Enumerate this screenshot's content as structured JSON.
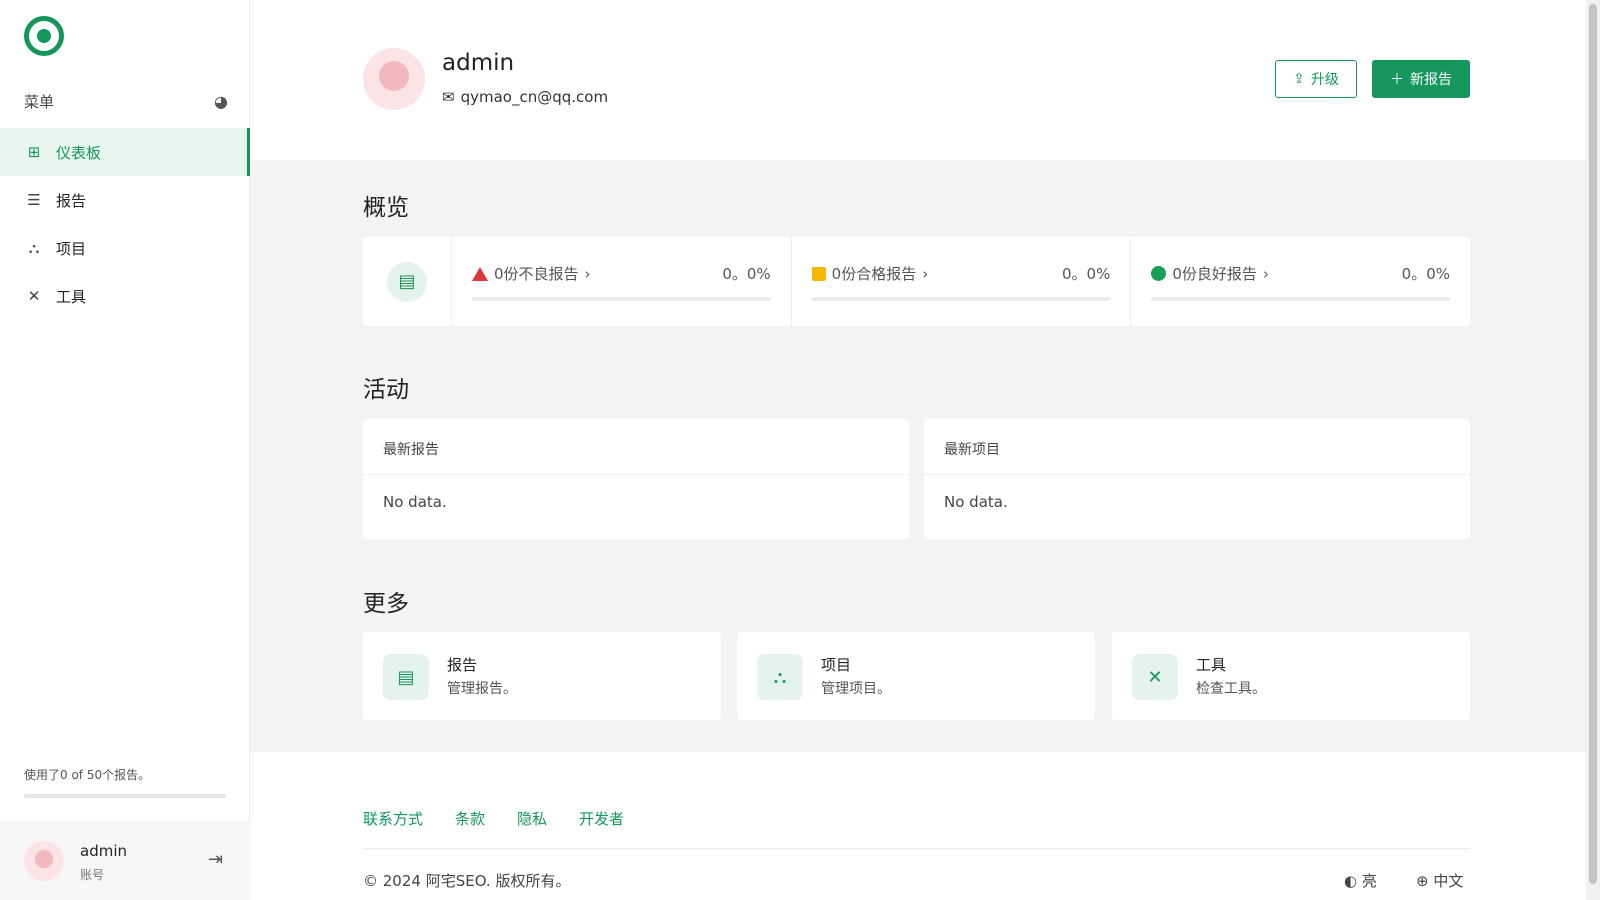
{
  "sidebar": {
    "menu_title": "菜单",
    "items": [
      {
        "label": "仪表板",
        "icon": "grid-icon"
      },
      {
        "label": "报告",
        "icon": "list-icon"
      },
      {
        "label": "项目",
        "icon": "project-icon"
      },
      {
        "label": "工具",
        "icon": "tools-icon"
      }
    ],
    "usage_text": "使用了0 of 50个报告。",
    "usage_fraction": 0,
    "user": {
      "name": "admin",
      "role": "账号"
    }
  },
  "header": {
    "name": "admin",
    "email": "qymao_cn@qq.com",
    "upgrade_label": "升级",
    "new_report_label": "新报告"
  },
  "overview": {
    "title": "概览",
    "items": [
      {
        "label": "0份不良报告",
        "percent": "0。0%",
        "status_color": "#d9363e"
      },
      {
        "label": "0份合格报告",
        "percent": "0。0%",
        "status_color": "#f5b800"
      },
      {
        "label": "0份良好报告",
        "percent": "0。0%",
        "status_color": "#18a058"
      }
    ]
  },
  "activity": {
    "title": "活动",
    "cards": [
      {
        "title": "最新报告",
        "empty": "No data."
      },
      {
        "title": "最新项目",
        "empty": "No data."
      }
    ]
  },
  "more": {
    "title": "更多",
    "cards": [
      {
        "title": "报告",
        "desc": "管理报告。"
      },
      {
        "title": "项目",
        "desc": "管理项目。"
      },
      {
        "title": "工具",
        "desc": "检查工具。"
      }
    ]
  },
  "footer": {
    "links": [
      "联系方式",
      "条款",
      "隐私",
      "开发者"
    ],
    "copyright": "© 2024 阿宅SEO. 版权所有。",
    "theme": "亮",
    "language": "中文"
  },
  "colors": {
    "accent": "#15965d"
  }
}
